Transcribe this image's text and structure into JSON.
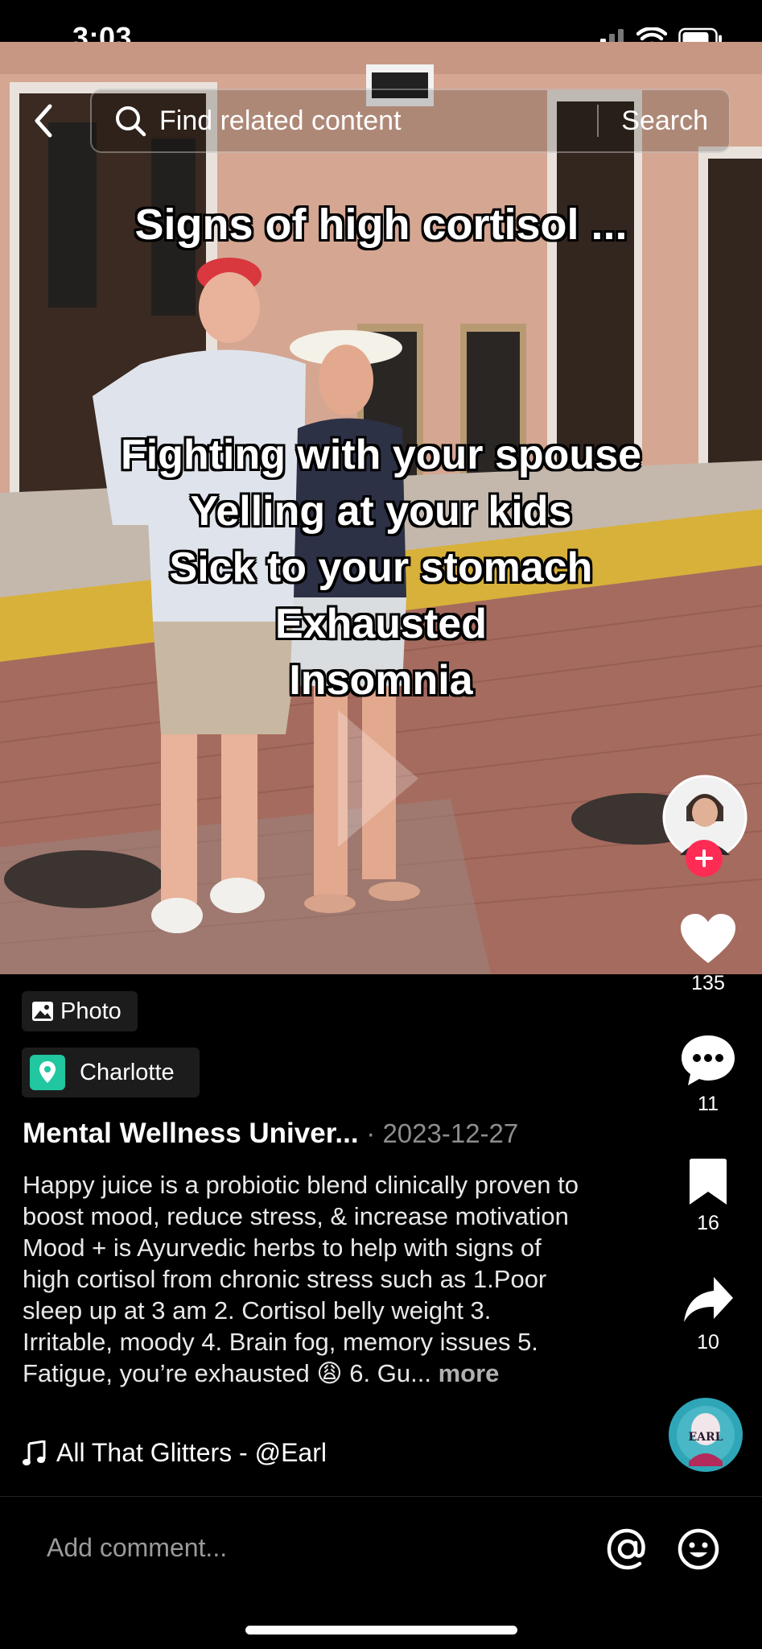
{
  "status_bar": {
    "time": "3:03"
  },
  "search": {
    "placeholder": "Find related content",
    "button": "Search"
  },
  "overlay": {
    "title": "Signs of high cortisol ...",
    "lines": [
      "Fighting with your spouse",
      "Yelling at your kids",
      "Sick to your stomach",
      "Exhausted",
      "Insomnia"
    ]
  },
  "rail": {
    "likes": "135",
    "comments": "11",
    "saves": "16",
    "shares": "10"
  },
  "badges": {
    "photo": "Photo",
    "location": "Charlotte"
  },
  "post": {
    "author": "Mental  Wellness  Univer...",
    "date": "· 2023-12-27",
    "caption": "Happy juice is a probiotic blend clinically proven to boost mood, reduce stress, & increase motivation  Mood + is Ayurvedic herbs to help with signs of high cortisol from chronic stress such as 1.Poor sleep up at 3 am 2. Cortisol belly weight 3. Irritable, moody 4. Brain fog, memory issues  5. Fatigue, you’re exhausted 😩  6. Gu...",
    "more": "more"
  },
  "music": {
    "title": "All That Glitters - @Earl"
  },
  "comment": {
    "placeholder": "Add comment..."
  },
  "colors": {
    "follow_plus": "#fe2c55",
    "location_pin": "#20c7a0",
    "background": "#000000"
  }
}
